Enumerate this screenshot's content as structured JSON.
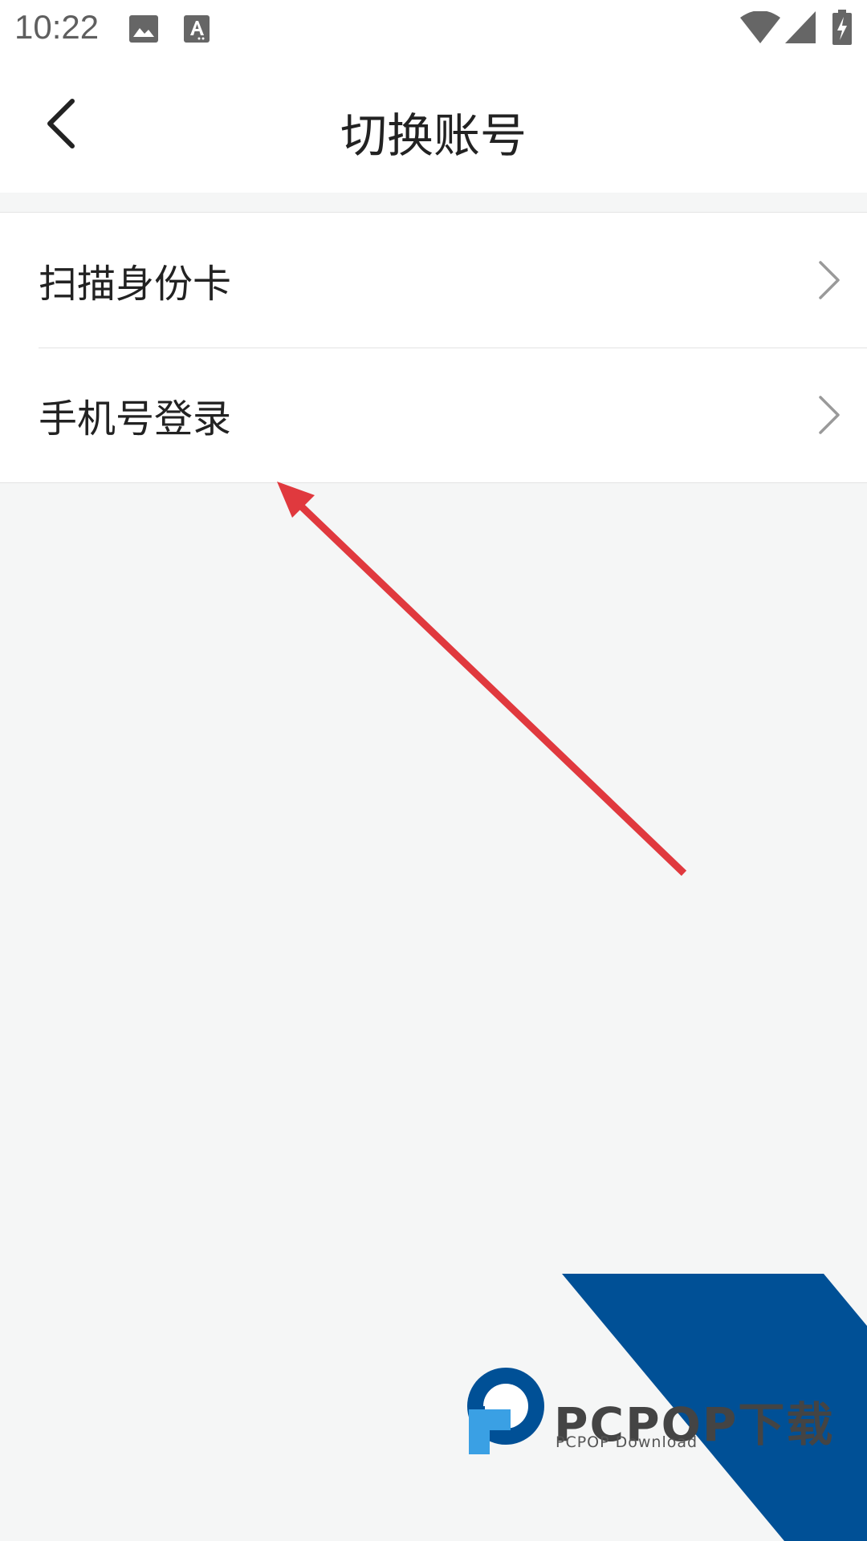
{
  "status_bar": {
    "time": "10:22",
    "icons": [
      "image-icon",
      "text-a-icon",
      "wifi-icon",
      "signal-icon",
      "battery-charging-icon"
    ]
  },
  "header": {
    "title": "切换账号",
    "back_icon": "chevron-left-icon"
  },
  "menu": {
    "items": [
      {
        "label": "扫描身份卡",
        "icon": "chevron-right-icon"
      },
      {
        "label": "手机号登录",
        "icon": "chevron-right-icon"
      }
    ]
  },
  "annotation": {
    "arrow_color": "#e0393e"
  },
  "watermark": {
    "brand": "PCPOP下载",
    "subtitle": "PCPOP Download",
    "colors": {
      "blue": "#005096",
      "light_blue": "#3aa0e4"
    }
  },
  "colors": {
    "background": "#f5f6f6",
    "surface": "#ffffff",
    "divider": "#e3e3e3",
    "text_primary": "#222222",
    "chevron": "#9a9a9a"
  }
}
